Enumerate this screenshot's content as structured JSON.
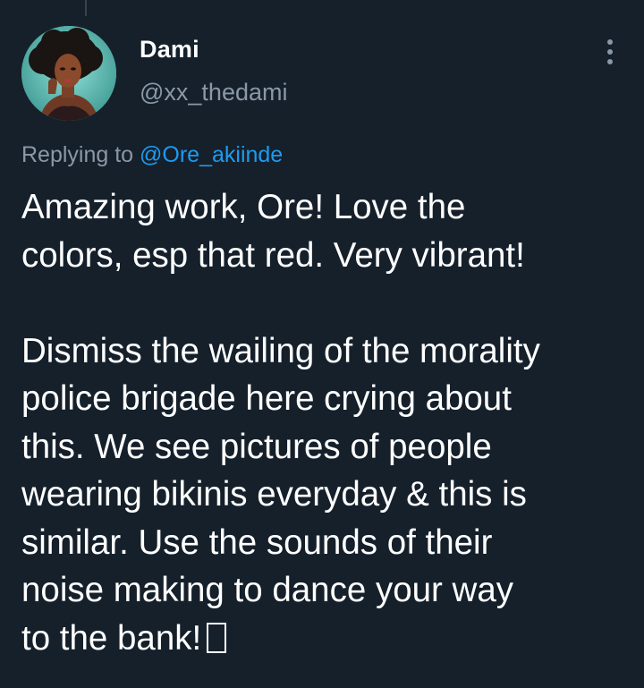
{
  "author": {
    "name": "Dami",
    "handle": "@xx_thedami"
  },
  "reply": {
    "prefix": "Replying to",
    "handle": "@Ore_akiinde"
  },
  "tweet": {
    "paragraph1": [
      "Amazing work, Ore! Love the",
      "colors, esp that red. Very vibrant!"
    ],
    "paragraph2": [
      "Dismiss the wailing of the morality",
      "police brigade here crying about",
      "this. We see pictures of people",
      "wearing bikinis everyday & this is",
      "similar. Use the sounds of their",
      "noise making to dance your way",
      "to the bank!"
    ],
    "trailing_emoji": "missing-glyph-box"
  },
  "icons": {
    "more": "more-vertical-icon",
    "avatar": "avatar-illustration"
  },
  "colors": {
    "background": "#15202b",
    "text_primary": "#ffffff",
    "text_secondary": "#8b98a5",
    "link": "#1d9bf0"
  }
}
